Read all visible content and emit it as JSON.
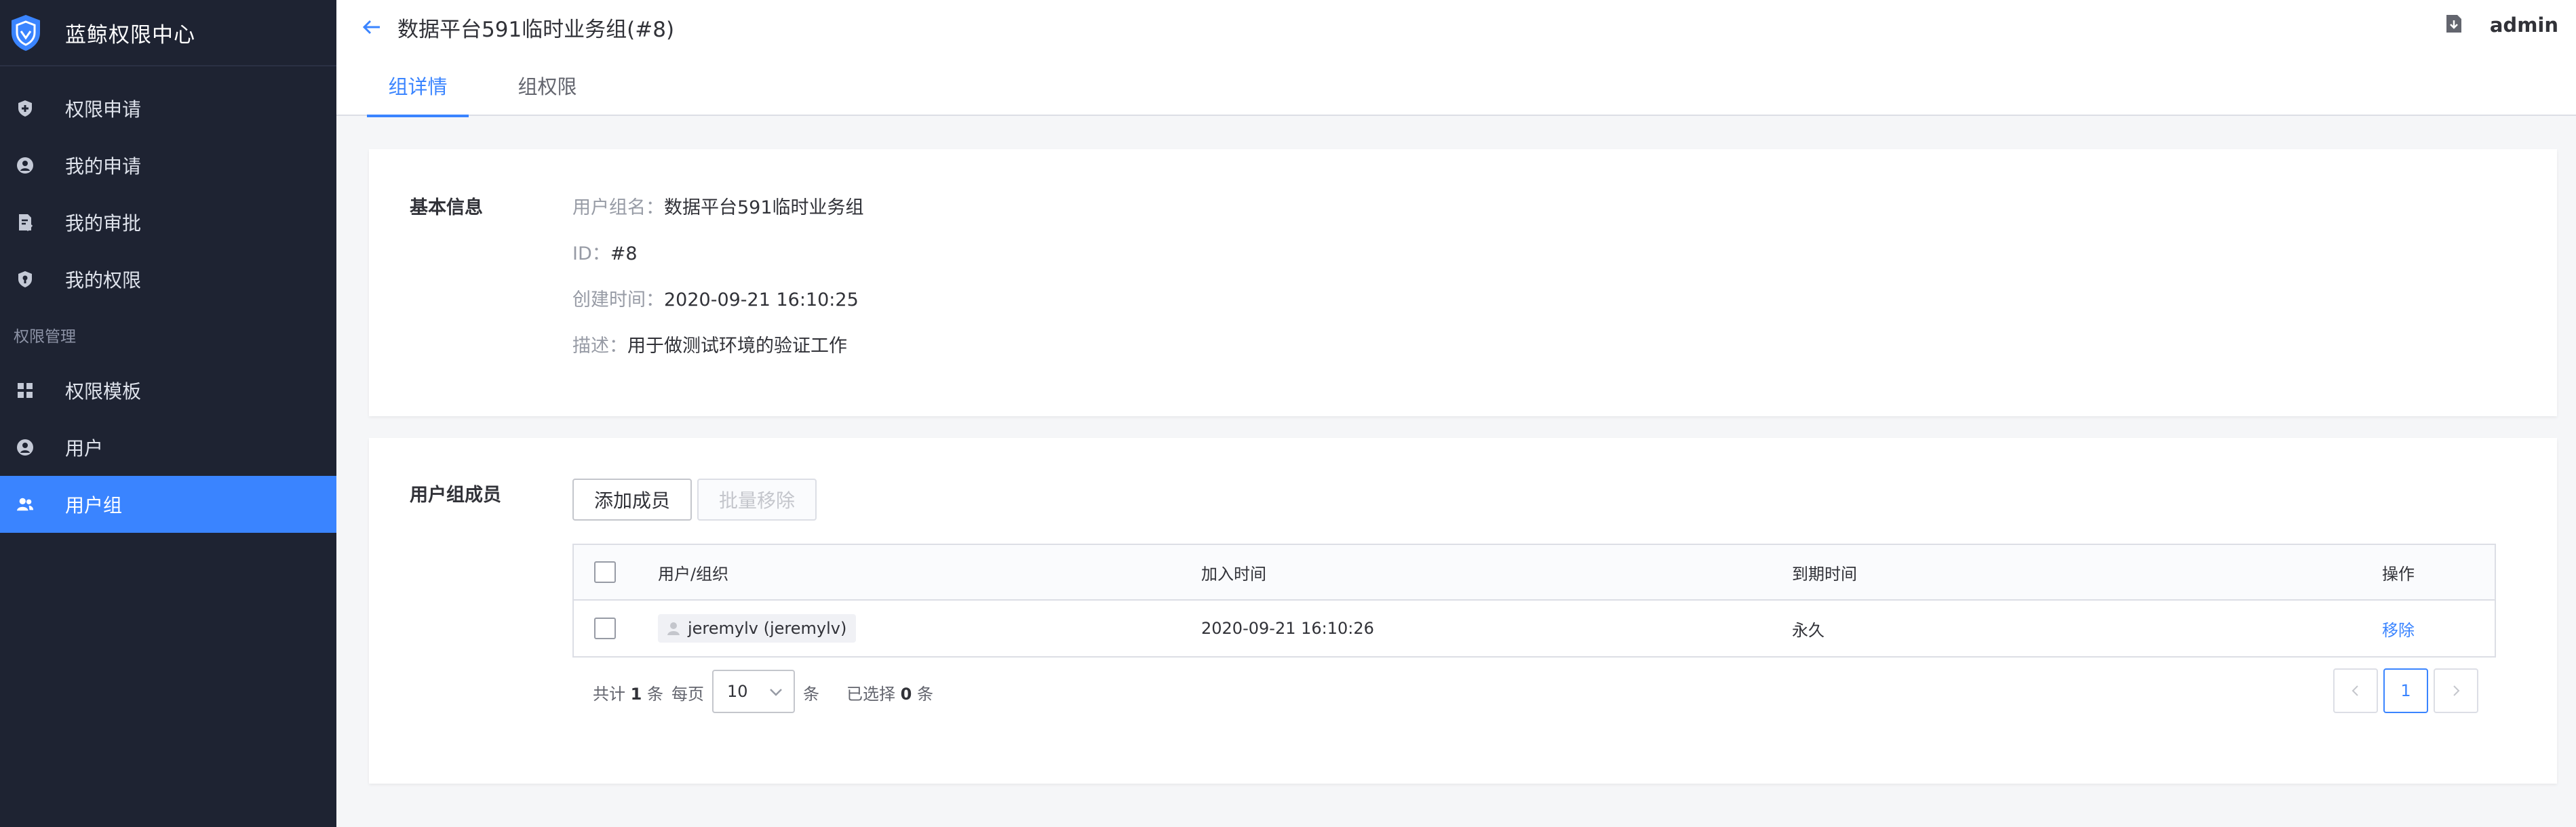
{
  "app": {
    "title": "蓝鲸权限中心"
  },
  "sidebar": {
    "items": [
      {
        "label": "权限申请",
        "icon": "shield-plus-icon"
      },
      {
        "label": "我的申请",
        "icon": "user-circle-icon"
      },
      {
        "label": "我的审批",
        "icon": "document-check-icon"
      },
      {
        "label": "我的权限",
        "icon": "shield-key-icon"
      }
    ],
    "group_label": "权限管理",
    "group_items": [
      {
        "label": "权限模板",
        "icon": "grid-icon"
      },
      {
        "label": "用户",
        "icon": "user-icon"
      },
      {
        "label": "用户组",
        "icon": "users-icon",
        "active": true
      }
    ]
  },
  "header": {
    "title": "数据平台591临时业务组(#8)",
    "user": "admin",
    "tabs": [
      {
        "label": "组详情",
        "active": true
      },
      {
        "label": "组权限",
        "active": false
      }
    ]
  },
  "basic_info": {
    "section_label": "基本信息",
    "name_key": "用户组名：",
    "name_value": "数据平台591临时业务组",
    "id_key": "ID：",
    "id_value": "#8",
    "created_key": "创建时间：",
    "created_value": "2020-09-21 16:10:25",
    "desc_key": "描述：",
    "desc_value": "用于做测试环境的验证工作"
  },
  "members": {
    "section_label": "用户组成员",
    "add_label": "添加成员",
    "batch_remove_label": "批量移除",
    "columns": [
      "用户/组织",
      "加入时间",
      "到期时间",
      "操作"
    ],
    "rows": [
      {
        "user": "jeremylv (jeremylv)",
        "joined": "2020-09-21 16:10:26",
        "expires": "永久",
        "action": "移除"
      }
    ],
    "pager": {
      "total_prefix": "共计",
      "total": "1",
      "total_suffix": "条",
      "per_page_label": "每页",
      "per_page": "10",
      "per_page_suffix": "条",
      "selected_prefix": "已选择",
      "selected": "0",
      "selected_suffix": "条",
      "current_page": "1"
    }
  },
  "colors": {
    "sidebar_bg": "#1e2332",
    "accent": "#3a84ff",
    "page_bg": "#f5f6f8"
  }
}
